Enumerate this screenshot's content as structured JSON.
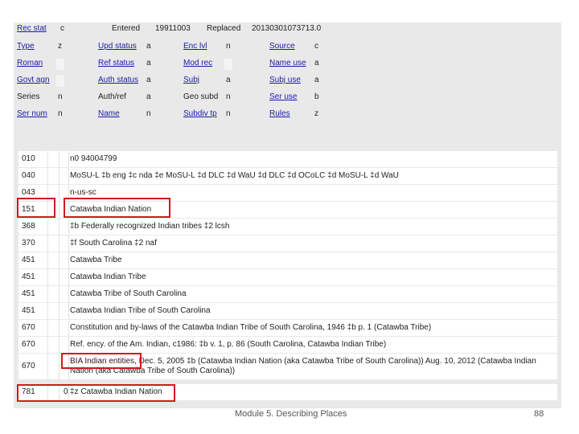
{
  "fixed_header": [
    {
      "label": "Rec stat",
      "value": "c"
    },
    {
      "label": "Entered",
      "value": "19911003"
    },
    {
      "label": "Replaced",
      "value": "20130301073713.0"
    }
  ],
  "fixed_fields": [
    [
      {
        "label": "Type",
        "value": "z"
      },
      {
        "label": "Upd status",
        "value": "a"
      },
      {
        "label": "Enc lvl",
        "value": "n"
      },
      {
        "label": "Source",
        "value": "c"
      }
    ],
    [
      {
        "label": "Roman",
        "value": ""
      },
      {
        "label": "Ref status",
        "value": "a"
      },
      {
        "label": "Mod rec",
        "value": ""
      },
      {
        "label": "Name use",
        "value": "a"
      }
    ],
    [
      {
        "label": "Govt agn",
        "value": ""
      },
      {
        "label": "Auth status",
        "value": "a"
      },
      {
        "label": "Subj",
        "value": "a"
      },
      {
        "label": "Subj use",
        "value": "a"
      }
    ],
    [
      {
        "label": "Series",
        "value": "n"
      },
      {
        "label": "Auth/ref",
        "value": "a"
      },
      {
        "label": "Geo subd",
        "value": "n"
      },
      {
        "label": "Ser use",
        "value": "b"
      }
    ],
    [
      {
        "label": "Ser num",
        "value": "n"
      },
      {
        "label": "Name",
        "value": "n"
      },
      {
        "label": "Subdiv tp",
        "value": "n"
      },
      {
        "label": "Rules",
        "value": "z"
      }
    ]
  ],
  "variable_fields": [
    {
      "tag": "010",
      "ind1": "",
      "ind2": "",
      "content": "n0 94004799"
    },
    {
      "tag": "040",
      "ind1": "",
      "ind2": "",
      "content": "MoSU-L ‡b eng ‡c nda ‡e MoSU-L ‡d DLC ‡d WaU ‡d DLC ‡d OCoLC ‡d MoSU-L ‡d WaU"
    },
    {
      "tag": "043",
      "ind1": "",
      "ind2": "",
      "content": "n-us-sc"
    },
    {
      "tag": "151",
      "ind1": "",
      "ind2": "",
      "content": "Catawba Indian Nation"
    },
    {
      "tag": "368",
      "ind1": "",
      "ind2": "",
      "content": "‡b Federally recognized Indian tribes ‡2 lcsh"
    },
    {
      "tag": "370",
      "ind1": "",
      "ind2": "",
      "content": "‡f South Carolina ‡2 naf"
    },
    {
      "tag": "451",
      "ind1": "",
      "ind2": "",
      "content": "Catawba Tribe"
    },
    {
      "tag": "451",
      "ind1": "",
      "ind2": "",
      "content": "Catawba Indian Tribe"
    },
    {
      "tag": "451",
      "ind1": "",
      "ind2": "",
      "content": "Catawba Tribe of South Carolina"
    },
    {
      "tag": "451",
      "ind1": "",
      "ind2": "",
      "content": "Catawba Indian Tribe of South Carolina"
    },
    {
      "tag": "670",
      "ind1": "",
      "ind2": "",
      "content": "Constitution and by-laws of the Catawba Indian Tribe of South Carolina, 1946 ‡b p. 1 (Catawba Tribe)"
    },
    {
      "tag": "670",
      "ind1": "",
      "ind2": "",
      "content": "Ref. ency. of the Am. Indian, c1986: ‡b v. 1, p. 86 (South Carolina, Catawba Indian Tribe)"
    },
    {
      "tag": "670",
      "ind1": "",
      "ind2": "",
      "content": "BIA Indian entities, Dec. 5, 2005 ‡b (Catawba Indian Nation (aka Catawba Tribe of South Carolina)) Aug. 10, 2012 (Catawba Indian Nation (aka Catawba Tribe of South Carolina))"
    },
    {
      "tag": "781",
      "ind1": "",
      "ind2": "0",
      "content": "‡z Catawba Indian Nation"
    }
  ],
  "footer": {
    "title": "Module 5. Describing Places",
    "page": "88"
  },
  "colors": {
    "highlight": "#d11a1a",
    "link": "#1a1aa6",
    "panel": "#e9e9e9"
  }
}
